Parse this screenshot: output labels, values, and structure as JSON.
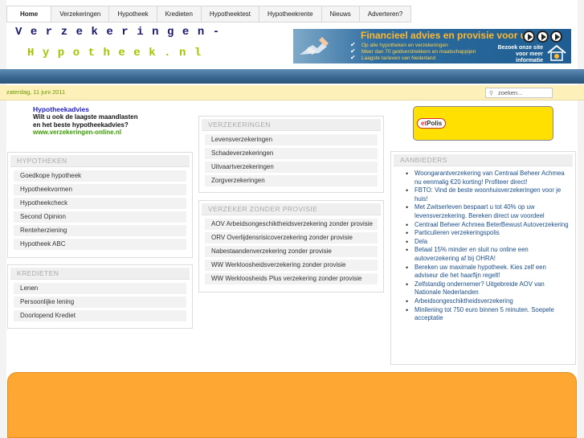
{
  "nav": {
    "tabs": [
      "Home",
      "Verzekeringen",
      "Hypotheek",
      "Kredieten",
      "Hypotheektest",
      "Hypotheekrente",
      "Nieuws",
      "Adverteren?"
    ]
  },
  "logo": {
    "line1": "Verzekeringen-",
    "line2": "Hypotheek.nl"
  },
  "banner": {
    "title": "Financieel advies en provisie voor u!",
    "bullets": [
      "Op alle hypotheken en verzekeringen",
      "Meer dan 70 geldverstrekkers en maatschappijen",
      "Laagste tarieven van Nederland"
    ],
    "visit_line1": "Bezoek onze site",
    "visit_line2": "voor meer informatie"
  },
  "date": "zaterdag, 11 juni 2011",
  "search": {
    "placeholder": "zoeken..."
  },
  "hypotheekadvies": {
    "title": "Hypotheekadvies",
    "line1": "Wilt u ook de laagste maandlasten",
    "line2": "en het beste hypotheekadvies?",
    "url": "www.verzekeringen-online.nl"
  },
  "hypotheken": {
    "header": "HYPOTHEKEN",
    "items": [
      "Goedkope hypotheek",
      "Hypotheekvormen",
      "Hypotheekcheck",
      "Second Opinion",
      "Renteherziening",
      "Hypotheek ABC"
    ]
  },
  "kredieten": {
    "header": "KREDIETEN",
    "items": [
      "Lenen",
      "Persoonlijke lening",
      "Doorlopend Krediet"
    ]
  },
  "verzekeringen": {
    "header": "VERZEKERINGEN",
    "items": [
      "Levensverzekeringen",
      "Schadeverzekeringen",
      "Uitvaartverzekeringen",
      "Zorgverzekeringen"
    ]
  },
  "zonder_provisie": {
    "header": "VERZEKER ZONDER PROVISIE",
    "items": [
      "AOV Arbeidsongeschiktheidsverzekering zonder provisie",
      "ORV Overlijdensrisicoverzekering zonder provisie",
      "Nabestaandenverzekering zonder provisie",
      "WW Werkloosheidsverzekering zonder provisie",
      "WW Werkloosheids Plus verzekering zonder provisie"
    ]
  },
  "netpolis": {
    "label_a": "et",
    "label_b": "Polis"
  },
  "aanbieders": {
    "header": "AANBIEDERS",
    "items": [
      "Woongarantverzekering van Centraal Beheer Achmea nu eenmalig €20 korting! Profiteer direct!",
      "FBTO: Vind de beste woonhuisverzekeringen voor je huis!",
      "Met Zwitserleven bespaart u tot 40% op uw levensverzekering. Bereken direct uw voordeel",
      "Centraal Beheer Achmea BeterBewust Autoverzekering",
      "Particulieren verzekeringspolis",
      "Dela",
      "Betaal 15% minder en sluit nu online een autoverzekering af bij OHRA!",
      "Bereken uw maximale hypotheek. Kies zelf een adviseur die het haarfijn regelt!",
      "Zelfstandig ondernemer? Uitgebreide AOV van Nationale Nederlanden",
      "Arbeidsongeschiktheidsverzekering",
      "Minilening tot 750 euro binnen 5 minuten. Soepele acceptatie"
    ]
  }
}
